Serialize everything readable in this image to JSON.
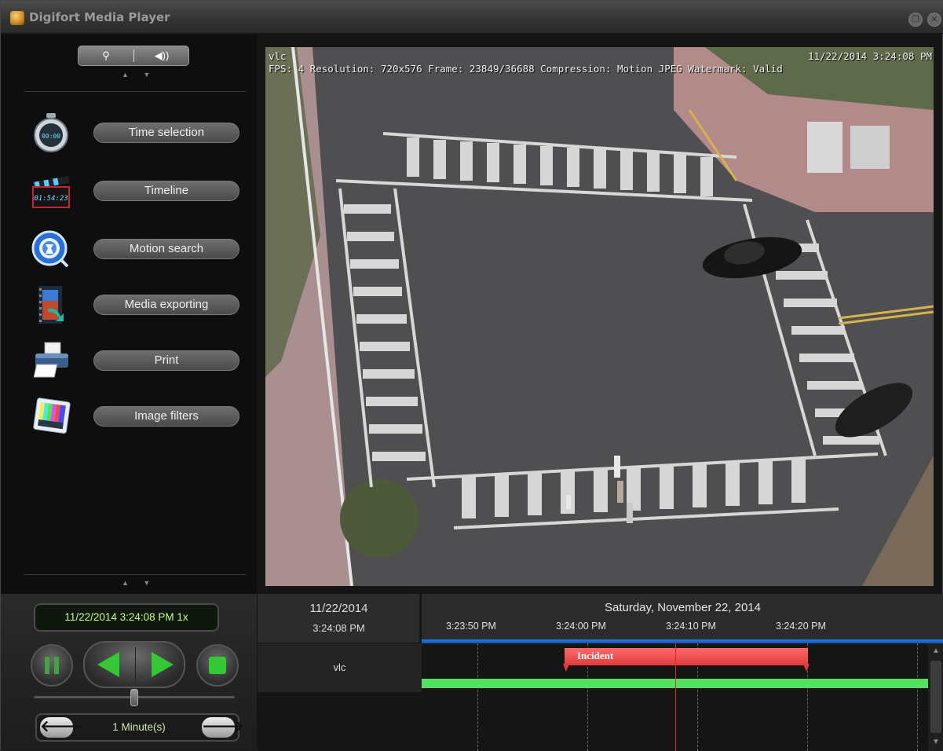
{
  "window": {
    "title": "Digifort Media Player",
    "restore_label": "❐",
    "close_label": "✕"
  },
  "sidebar": {
    "mode_buttons": [
      {
        "icon": "joystick-icon",
        "label": "⚲"
      },
      {
        "icon": "speaker-icon",
        "label": "◀))"
      }
    ],
    "scroll_arrows": "▲ ▼",
    "items": [
      {
        "label": "Time selection",
        "icon": "stopwatch-icon"
      },
      {
        "label": "Timeline",
        "icon": "clapperboard-icon"
      },
      {
        "label": "Motion search",
        "icon": "motion-search-icon"
      },
      {
        "label": "Media exporting",
        "icon": "film-export-icon"
      },
      {
        "label": "Print",
        "icon": "printer-icon"
      },
      {
        "label": "Image filters",
        "icon": "image-filter-icon"
      }
    ],
    "stopwatch_text": "00:00",
    "clapper_text": "01:54:23"
  },
  "video": {
    "camera": "vlc",
    "info": "FPS: 4   Resolution: 720x576   Frame: 23849/36688   Compression: Motion JPEG   Watermark: Valid",
    "timestamp": "11/22/2014 3:24:08 PM"
  },
  "playback": {
    "current_time": "11/22/2014 3:24:08 PM 1x",
    "step_label": "1 Minute(s)",
    "step_back": "🡐",
    "step_forward": "🡒",
    "speed_fraction": 0.5
  },
  "timeline": {
    "date": "11/22/2014",
    "time": "3:24:08 PM",
    "day": "Saturday, November 22, 2014",
    "ticks": [
      "3:23:50 PM",
      "3:24:00 PM",
      "3:24:10 PM",
      "3:24:20 PM"
    ],
    "track": "vlc",
    "event_label": "Incident"
  },
  "colors": {
    "recording": "#55e05f",
    "event": "#e23b3b",
    "cursor": "#e32a2a",
    "header_line": "#2a78e8",
    "time_text": "#c6ff7a"
  }
}
